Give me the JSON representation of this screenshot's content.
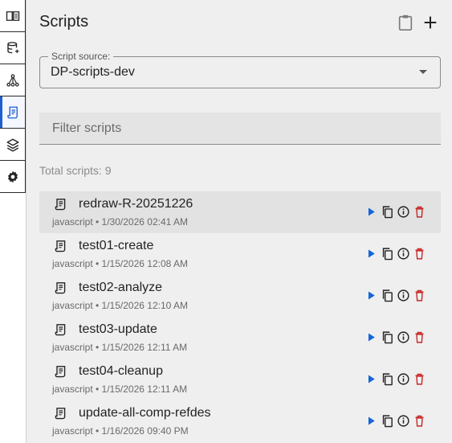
{
  "panel": {
    "title": "Scripts",
    "header_actions": [
      {
        "name": "clipboard-icon"
      },
      {
        "name": "plus-icon"
      }
    ]
  },
  "rail": {
    "items": [
      {
        "icon": "book-icon"
      },
      {
        "icon": "database-icon"
      },
      {
        "icon": "hierarchy-icon"
      },
      {
        "icon": "script-icon",
        "active": true
      },
      {
        "icon": "layers-icon"
      },
      {
        "icon": "gear-icon"
      }
    ]
  },
  "script_source": {
    "label": "Script source:",
    "value": "DP-scripts-dev"
  },
  "filter": {
    "placeholder": "Filter scripts",
    "value": ""
  },
  "total": {
    "label": "Total scripts: 9"
  },
  "scripts": [
    {
      "name": "redraw-R-20251226",
      "meta": "javascript • 1/30/2026 02:41 AM",
      "selected": true
    },
    {
      "name": "test01-create",
      "meta": "javascript • 1/15/2026 12:08 AM"
    },
    {
      "name": "test02-analyze",
      "meta": "javascript • 1/15/2026 12:10 AM"
    },
    {
      "name": "test03-update",
      "meta": "javascript • 1/15/2026 12:11 AM"
    },
    {
      "name": "test04-cleanup",
      "meta": "javascript • 1/15/2026 12:11 AM"
    },
    {
      "name": "update-all-comp-refdes",
      "meta": "javascript • 1/16/2026 09:40 PM"
    }
  ],
  "colors": {
    "accent": "#1e5fd0",
    "run": "#1565d8",
    "delete": "#c62828"
  }
}
